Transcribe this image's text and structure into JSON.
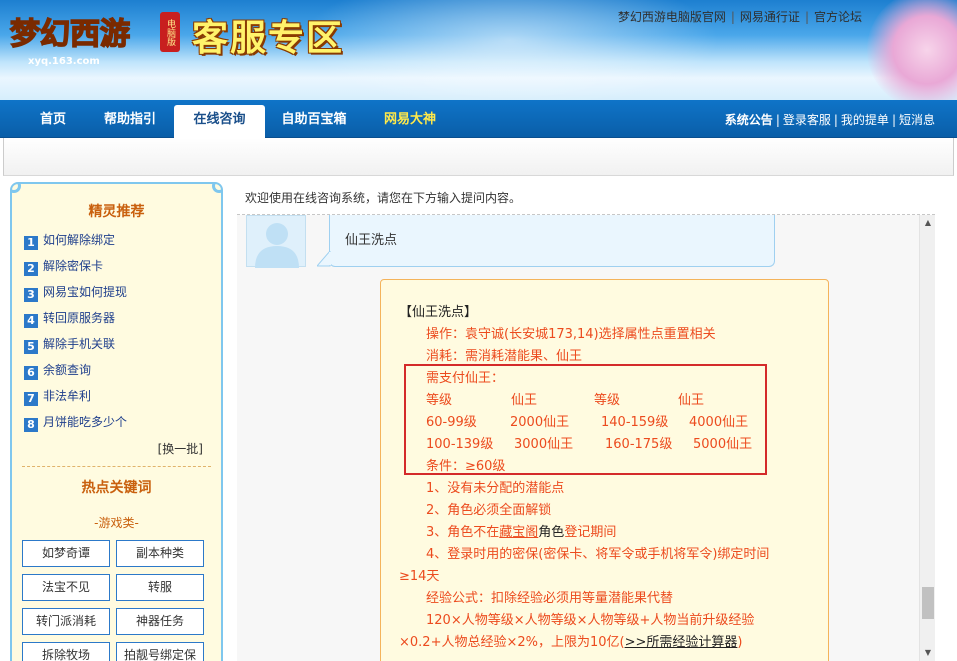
{
  "header": {
    "logo_text": "梦幻西游",
    "logo_domain": "xyq.163.com",
    "logo_badge": "电脑版",
    "zone_title": "客服专区",
    "top_links": [
      "梦幻西游电脑版官网",
      "网易通行证",
      "官方论坛"
    ]
  },
  "nav": {
    "tabs": [
      {
        "label": "首页"
      },
      {
        "label": "帮助指引"
      },
      {
        "label": "在线咨询"
      },
      {
        "label": "自助百宝箱"
      },
      {
        "label": "网易大神"
      }
    ],
    "right_links": [
      "系统公告",
      "登录客服",
      "我的提单",
      "短消息"
    ]
  },
  "sidebar": {
    "recommend_title": "精灵推荐",
    "items": [
      {
        "num": "1",
        "label": "如何解除绑定"
      },
      {
        "num": "2",
        "label": "解除密保卡"
      },
      {
        "num": "3",
        "label": "网易宝如何提现"
      },
      {
        "num": "4",
        "label": "转回原服务器"
      },
      {
        "num": "5",
        "label": "解除手机关联"
      },
      {
        "num": "6",
        "label": "余额查询"
      },
      {
        "num": "7",
        "label": "非法牟利"
      },
      {
        "num": "8",
        "label": "月饼能吃多少个"
      }
    ],
    "refresh": "[换一批]",
    "hot_title": "热点关键词",
    "category": "-游戏类-",
    "keywords": [
      "如梦奇谭",
      "副本种类",
      "法宝不见",
      "转服",
      "转门派消耗",
      "神器任务",
      "拆除牧场",
      "拍靓号绑定保"
    ]
  },
  "main": {
    "welcome": "欢迎使用在线咨询系统，请您在下方输入提问内容。",
    "user_message": "仙王洗点",
    "answer": {
      "title": "【仙王洗点】",
      "op": "操作：袁守诚(长安城173,14)选择属性点重置相关",
      "cost": "消耗：需消耗潜能果、仙王",
      "need": "需支付仙王：",
      "table_header": [
        "等级",
        "仙王",
        "等级",
        "仙王"
      ],
      "table_rows": [
        [
          "60-99级",
          "2000仙王",
          "140-159级",
          "4000仙王"
        ],
        [
          "100-139级",
          "3000仙王",
          "160-175级",
          "5000仙王"
        ]
      ],
      "condition": "条件：≥60级",
      "c1": "1、没有未分配的潜能点",
      "c2": "2、角色必须全面解锁",
      "c3_a": "3、角色不在",
      "c3_link": "藏宝阁",
      "c3_b": "角色",
      "c3_c": "登记期间",
      "c4": "4、登录时用的密保(密保卡、将军令或手机将军令)绑定时间",
      "c4b": "≥14天",
      "exp": "经验公式：扣除经验必须用等量潜能果代替",
      "formula": "120×人物等级×人物等级×人物等级+人物当前升级经验",
      "formula2_a": "×0.2+人物总经验×2%，上限为10亿(",
      "formula2_link": ">>所需经验计算器",
      "formula2_b": ")"
    }
  },
  "colors": {
    "nav_blue": "#0a5ea8",
    "answer_orange": "#ec4b1e",
    "highlight_red": "#d42a2a",
    "sidebar_bg": "#fffbe0"
  }
}
